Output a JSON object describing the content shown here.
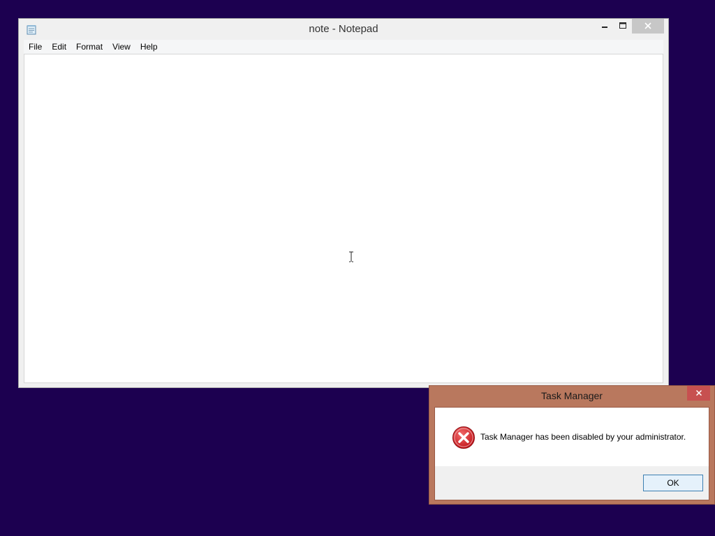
{
  "notepad": {
    "title": "note - Notepad",
    "app_icon": "notepad-icon",
    "menu": [
      "File",
      "Edit",
      "Format",
      "View",
      "Help"
    ],
    "content": ""
  },
  "dialog": {
    "title": "Task Manager",
    "message": "Task Manager has been disabled by your administrator.",
    "icon": "error-icon",
    "ok_label": "OK"
  },
  "colors": {
    "desktop": "#1c0050",
    "dialog_frame": "#b9785e",
    "dialog_close": "#c75050",
    "error_red": "#d9262e"
  }
}
